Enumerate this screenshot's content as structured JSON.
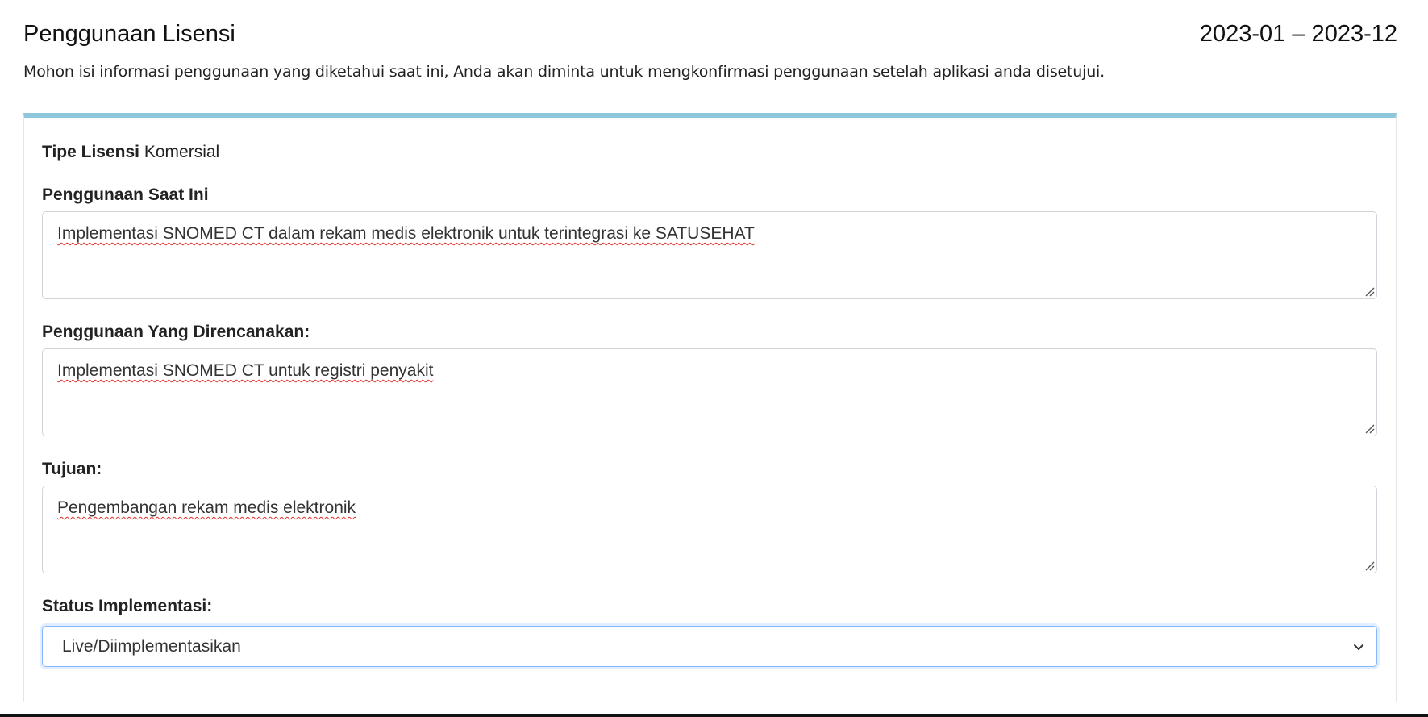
{
  "header": {
    "title": "Penggunaan Lisensi",
    "period": "2023-01 – 2023-12",
    "intro": "Mohon isi informasi penggunaan yang diketahui saat ini, Anda akan diminta untuk mengkonfirmasi penggunaan setelah aplikasi anda disetujui."
  },
  "license": {
    "type_label": "Tipe Lisensi",
    "type_value": "Komersial"
  },
  "fields": {
    "current_use": {
      "label": "Penggunaan Saat Ini",
      "value": "Implementasi SNOMED CT dalam rekam medis elektronik untuk terintegrasi ke SATUSEHAT"
    },
    "planned_use": {
      "label": "Penggunaan Yang Direncanakan:",
      "value": "Implementasi SNOMED CT untuk registri penyakit"
    },
    "purpose": {
      "label": "Tujuan:",
      "value": "Pengembangan rekam medis elektronik"
    },
    "status": {
      "label": "Status Implementasi:",
      "selected": "Live/Diimplementasikan"
    }
  },
  "icons": {
    "resize": "resize-handle-icon",
    "select_arrow": "chevron-down-icon"
  },
  "colors": {
    "card_accent": "#8fc7dc",
    "focus_border": "#86b7fe",
    "spellcheck": "#e0302a"
  }
}
